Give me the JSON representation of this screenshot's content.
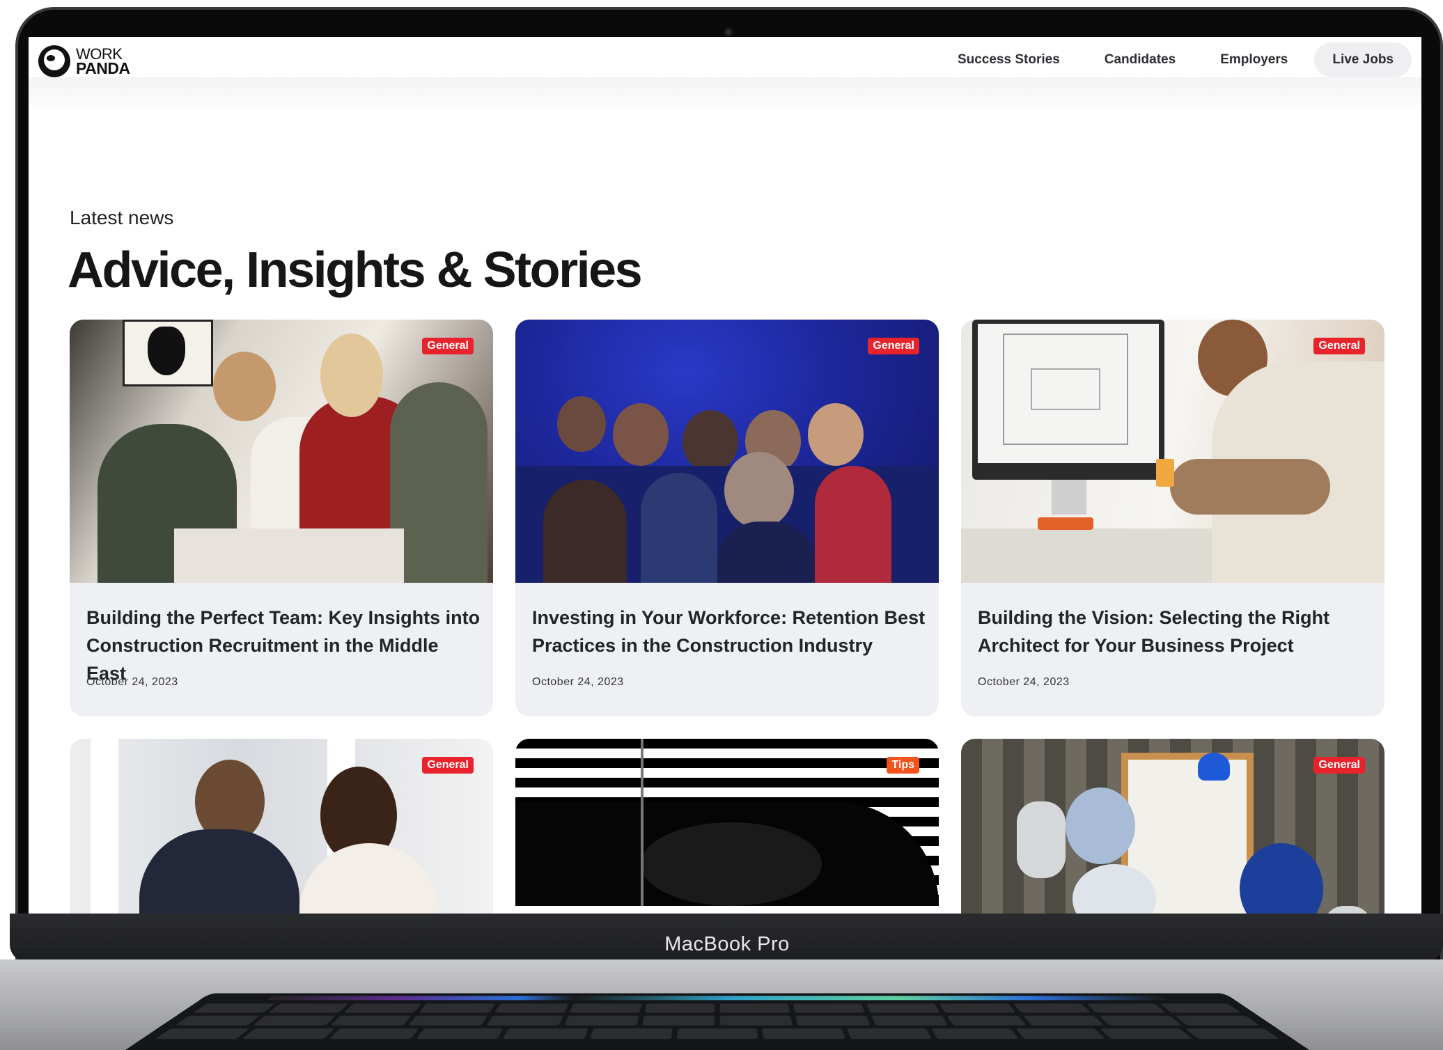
{
  "device": {
    "label": "MacBook Pro"
  },
  "nav": {
    "logo_top": "WORK",
    "logo_bottom": "PANDA",
    "links": [
      {
        "label": "Success Stories"
      },
      {
        "label": "Candidates"
      },
      {
        "label": "Employers"
      },
      {
        "label": "Live Jobs"
      }
    ]
  },
  "section": {
    "eyebrow": "Latest news",
    "title": "Advice, Insights & Stories"
  },
  "colors": {
    "badge_general": "#e8232b",
    "badge_tips": "#f2521b",
    "card_bg": "#eef0f3"
  },
  "articles": [
    {
      "badge": "General",
      "title": "Building the Perfect Team: Key Insights into Construction Recruitment in the Middle East",
      "date": "October 24, 2023"
    },
    {
      "badge": "General",
      "title": "Investing in Your Workforce: Retention Best Practices in the Construction Industry",
      "date": "October 24, 2023"
    },
    {
      "badge": "General",
      "title": "Building the Vision: Selecting the Right Architect for Your Business Project",
      "date": "October 24, 2023"
    },
    {
      "badge": "General"
    },
    {
      "badge": "Tips"
    },
    {
      "badge": "General"
    }
  ]
}
